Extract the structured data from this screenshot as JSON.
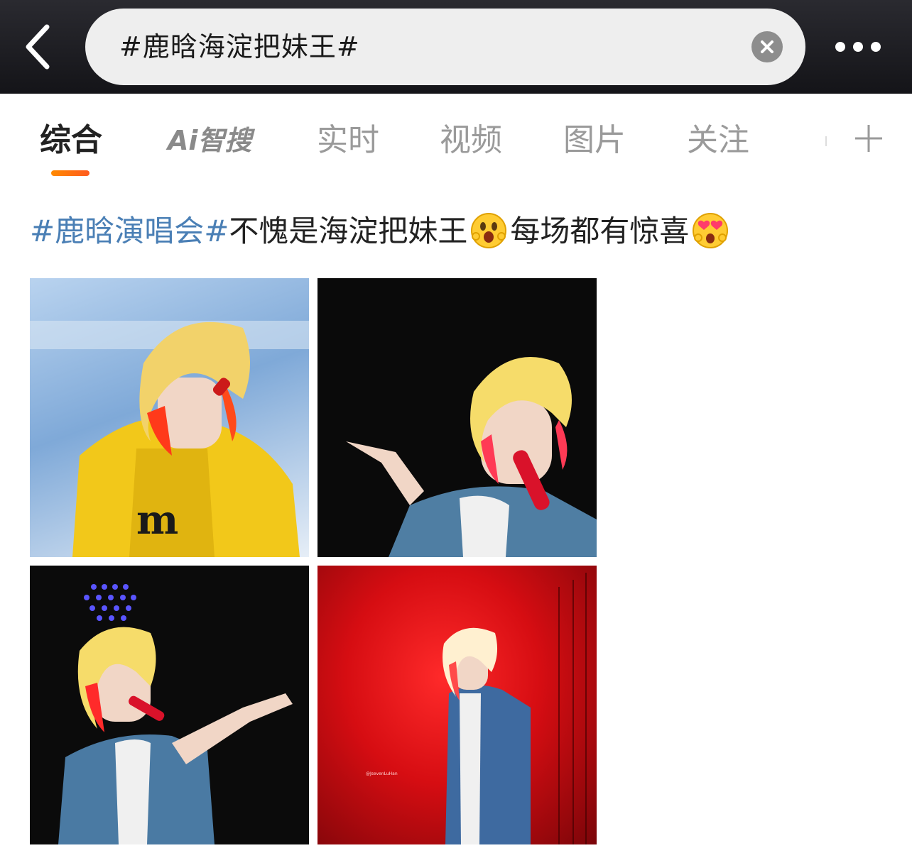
{
  "search": {
    "query": "#鹿晗海淀把妹王#"
  },
  "tabs": [
    {
      "label": "综合",
      "active": true
    },
    {
      "label": "Ai智搜",
      "active": false
    },
    {
      "label": "实时",
      "active": false
    },
    {
      "label": "视频",
      "active": false
    },
    {
      "label": "图片",
      "active": false
    },
    {
      "label": "关注",
      "active": false
    }
  ],
  "post": {
    "topic": "#鹿晗演唱会#",
    "text_part1": "不愧是海淀把妹王",
    "text_part2": "每场都有惊喜",
    "emoji1": "surprised-face-emoji",
    "emoji2": "heart-eyes-emoji"
  },
  "photos": [
    {
      "name": "concert-photo-yellow-jacket"
    },
    {
      "name": "concert-photo-pointing"
    },
    {
      "name": "concert-photo-arm-outstretched"
    },
    {
      "name": "concert-photo-red-stage",
      "watermark": "@JsevenLuHan"
    }
  ],
  "colors": {
    "topbar": "#1c1c20",
    "topic_link": "#4a7fb5",
    "tab_underline": "#ff7a10",
    "active_tab": "#222222",
    "inactive_tab": "#9a9a9a"
  }
}
